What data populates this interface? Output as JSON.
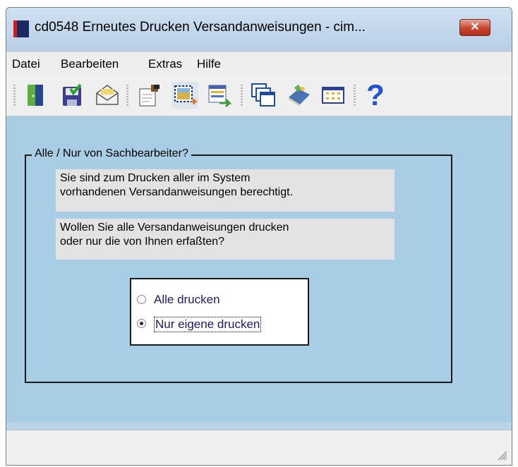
{
  "window": {
    "title": "cd0548 Erneutes Drucken Versandanweisungen - cim...",
    "close_label": "✕"
  },
  "menu": [
    "Datei",
    "Bearbeiten",
    "Extras",
    "Hilfe"
  ],
  "toolbar": {
    "icons": [
      "exit-door-icon",
      "save-icon",
      "envelope-icon",
      "edit-document-icon",
      "select-frame-icon",
      "transfer-list-icon",
      "windows-icon",
      "book-icon",
      "calendar-grid-icon",
      "help-icon"
    ],
    "help_glyph": "?"
  },
  "group": {
    "legend": "Alle / Nur von Sachbearbeiter?",
    "info_line1": "Sie sind zum Drucken aller im System",
    "info_line2": "vorhandenen Versandanweisungen berechtigt.",
    "question_line1": "Wollen Sie alle Versandanweisungen drucken",
    "question_line2": "oder nur die von Ihnen erfaßten?"
  },
  "radios": {
    "option_all": "Alle drucken",
    "option_own": "Nur eigene drucken",
    "selected": "option_own"
  },
  "colors": {
    "content_bg": "#a9cde4",
    "title_bg": "#bcd4e8",
    "close_red": "#c7442f"
  }
}
